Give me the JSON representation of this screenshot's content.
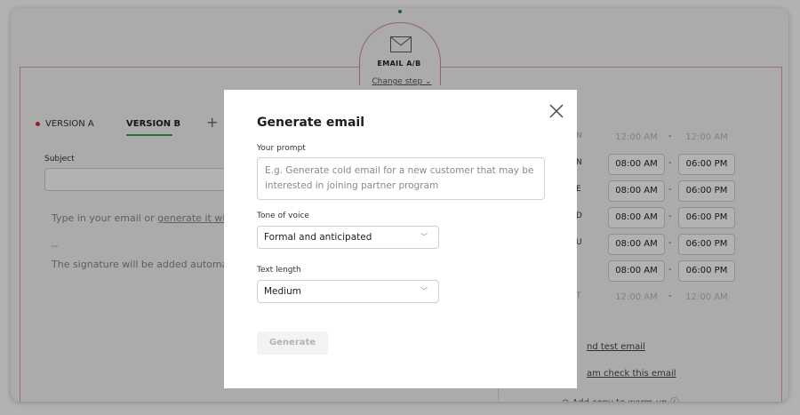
{
  "flow": {
    "step_label": "EMAIL A/B",
    "change_step": "Change step ⌄"
  },
  "editor": {
    "version_a": "VERSION A",
    "version_b": "VERSION B",
    "add_version": "+",
    "subject_label": "Subject",
    "body_placeholder_prefix": "Type in your email or ",
    "body_placeholder_link": "generate it with",
    "signature_separator": "--",
    "signature_text": "The signature will be added automati"
  },
  "schedule": {
    "rows": [
      {
        "day": "N",
        "from": "12:00 AM",
        "to": "12:00 AM",
        "enabled": false
      },
      {
        "day": "N",
        "from": "08:00 AM",
        "to": "06:00 PM",
        "enabled": true
      },
      {
        "day": "E",
        "from": "08:00 AM",
        "to": "06:00 PM",
        "enabled": true
      },
      {
        "day": "D",
        "from": "08:00 AM",
        "to": "06:00 PM",
        "enabled": true
      },
      {
        "day": "U",
        "from": "08:00 AM",
        "to": "06:00 PM",
        "enabled": true
      },
      {
        "day": "",
        "from": "08:00 AM",
        "to": "06:00 PM",
        "enabled": true
      },
      {
        "day": "T",
        "from": "12:00 AM",
        "to": "12:00 AM",
        "enabled": false
      }
    ],
    "dash": "-"
  },
  "right_links": {
    "send_test": "nd test email",
    "spam_check": "am check this email",
    "warmup": "⊙  Add copy to warm-up ⓘ"
  },
  "modal": {
    "title": "Generate email",
    "prompt_label": "Your prompt",
    "prompt_placeholder": "E.g. Generate cold email for a new customer that may be interested in joining partner program",
    "tone_label": "Tone of voice",
    "tone_value": "Formal and anticipated",
    "length_label": "Text length",
    "length_value": "Medium",
    "generate_label": "Generate"
  },
  "colors": {
    "accent_green": "#3ba55c",
    "accent_red": "#d62c3c"
  }
}
